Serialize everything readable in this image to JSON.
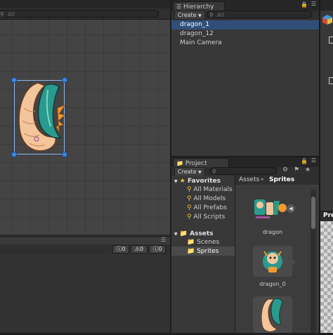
{
  "scene": {
    "search_placeholder": "All"
  },
  "hierarchy": {
    "tab_label": "Hierarchy",
    "create_label": "Create",
    "search_placeholder": "All",
    "items": [
      "dragon_1",
      "dragon_12",
      "Main Camera"
    ]
  },
  "console_bar": {
    "info_count": "0",
    "warn_count": "0",
    "error_count": "0"
  },
  "project": {
    "tab_label": "Project",
    "create_label": "Create",
    "favorites_label": "Favorites",
    "favorites": [
      "All Materials",
      "All Models",
      "All Prefabs",
      "All Scripts"
    ],
    "assets_label": "Assets",
    "folders": [
      "Scenes",
      "Sprites"
    ],
    "breadcrumb": {
      "root": "Assets",
      "separator": "▸",
      "current": "Sprites"
    },
    "asset_names": [
      "dragon",
      "dragon_0"
    ]
  },
  "inspector": {
    "preview_label": "Pre"
  },
  "colors": {
    "selection_blue": "#3d86e6",
    "hier_selected_bg": "#2f4f7a",
    "favorites_star": "#e8c23a"
  },
  "icons": [
    "search-icon",
    "dropdown-arrow-icon",
    "lock-icon",
    "menu-icon",
    "star-icon",
    "folder-icon",
    "info-icon",
    "warning-icon",
    "error-icon"
  ]
}
